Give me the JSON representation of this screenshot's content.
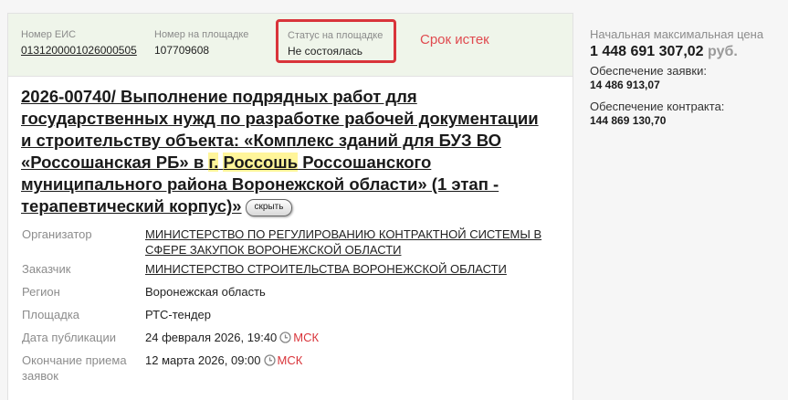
{
  "purchase": {
    "eis_label": "Номер ЕИС",
    "eis_number": "0131200001026000505",
    "platform_number_label": "Номер на площадке",
    "platform_number": "107709608",
    "status_label": "Статус на площадке",
    "status_value": "Не состоялась",
    "expired_label": "Срок истек",
    "title_part1": "2026-00740/ Выполнение подрядных работ для государственных нужд по разработке рабочей документации и строительству объекта: «Комплекс зданий для БУЗ ВО «Россошанская РБ» в ",
    "title_hl1": "г.",
    "title_space": " ",
    "title_hl2": "Россошь",
    "title_part2": " Россошанского муниципального района Воронежской области» (1 этап - терапевтический корпус)»",
    "hide_button": "скрыть"
  },
  "details": {
    "organizer_label": "Организатор",
    "organizer_value": "МИНИСТЕРСТВО ПО РЕГУЛИРОВАНИЮ КОНТРАКТНОЙ СИСТЕМЫ В СФЕРЕ ЗАКУПОК ВОРОНЕЖСКОЙ ОБЛАСТИ",
    "customer_label": "Заказчик",
    "customer_value": "МИНИСТЕРСТВО СТРОИТЕЛЬСТВА ВОРОНЕЖСКОЙ ОБЛАСТИ",
    "region_label": "Регион",
    "region_value": "Воронежская область",
    "platform_label": "Площадка",
    "platform_value": "РТС-тендер",
    "pub_date_label": "Дата публикации",
    "pub_date_value": "24 февраля 2026, 19:40",
    "end_date_label": "Окончание приема заявок",
    "end_date_value": "12 марта 2026, 09:00",
    "timezone": "МСК"
  },
  "price": {
    "initial_label": "Начальная максимальная цена",
    "initial_value": "1 448 691 307,02",
    "currency": "руб.",
    "bid_security_label": "Обеспечение заявки:",
    "bid_security_value": "14 486 913,07",
    "contract_security_label": "Обеспечение контракта:",
    "contract_security_value": "144 869 130,70"
  },
  "colors": {
    "status_border": "#d9343a",
    "header_bg": "#eff5ea",
    "highlight": "#fff59a"
  },
  "icons": {
    "time": "clock-icon"
  }
}
